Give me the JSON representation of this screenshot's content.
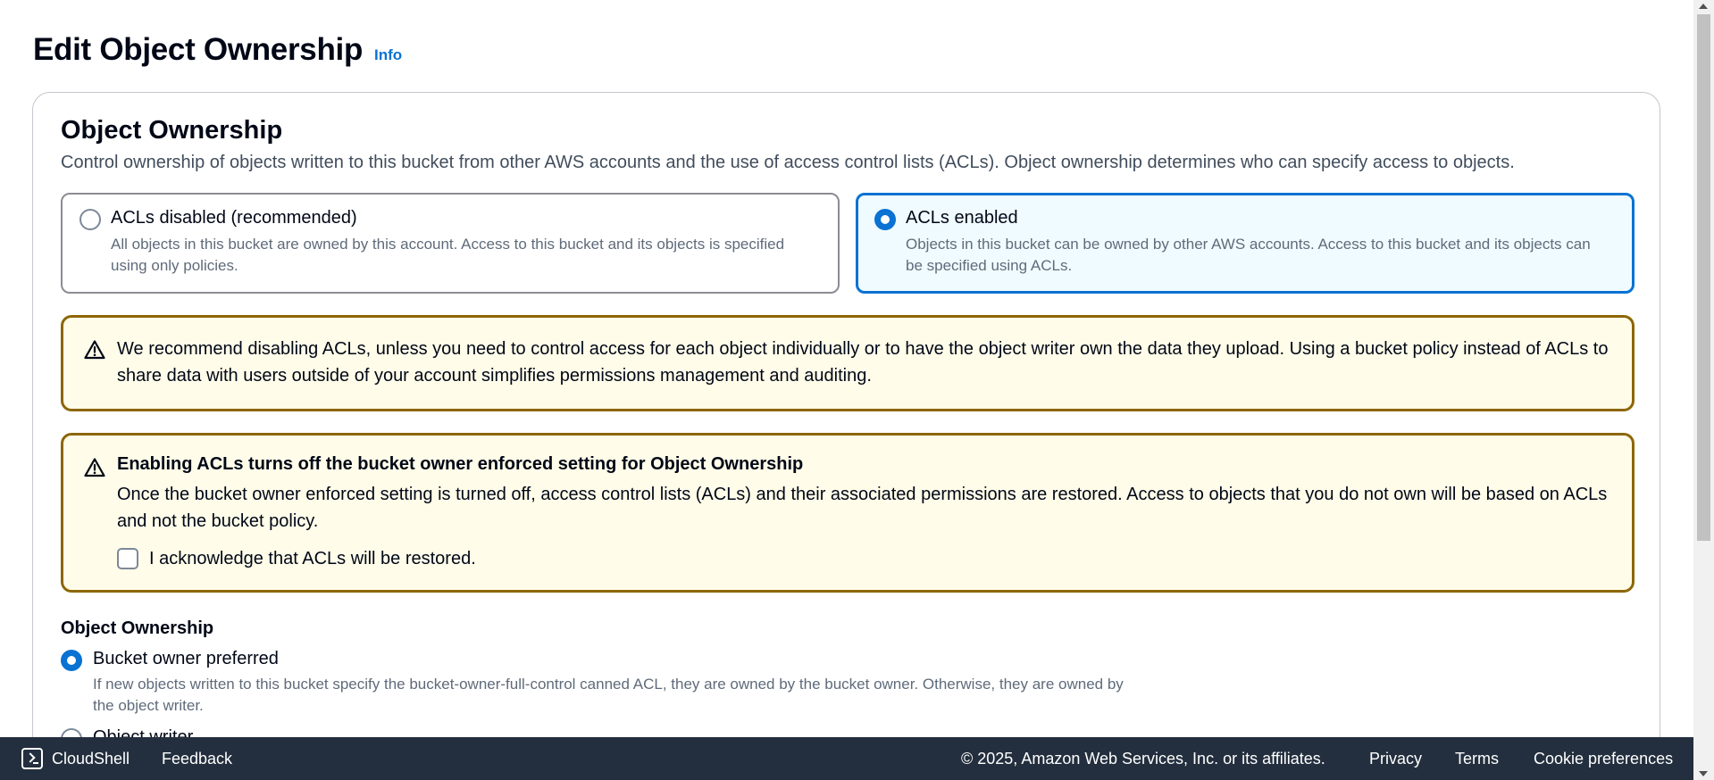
{
  "header": {
    "title": "Edit Object Ownership",
    "info_link": "Info"
  },
  "panel": {
    "title": "Object Ownership",
    "description": "Control ownership of objects written to this bucket from other AWS accounts and the use of access control lists (ACLs). Object ownership determines who can specify access to objects.",
    "tiles": [
      {
        "label": "ACLs disabled (recommended)",
        "description": "All objects in this bucket are owned by this account. Access to this bucket and its objects is specified using only policies.",
        "selected": false
      },
      {
        "label": "ACLs enabled",
        "description": "Objects in this bucket can be owned by other AWS accounts. Access to this bucket and its objects can be specified using ACLs.",
        "selected": true
      }
    ],
    "warning_recommend": {
      "text": "We recommend disabling ACLs, unless you need to control access for each object individually or to have the object writer own the data they upload. Using a bucket policy instead of ACLs to share data with users outside of your account simplifies permissions management and auditing."
    },
    "warning_enabling": {
      "title": "Enabling ACLs turns off the bucket owner enforced setting for Object Ownership",
      "text": "Once the bucket owner enforced setting is turned off, access control lists (ACLs) and their associated permissions are restored. Access to objects that you do not own will be based on ACLs and not the bucket policy.",
      "acknowledge_label": "I acknowledge that ACLs will be restored.",
      "acknowledge_checked": false
    },
    "ownership_field": {
      "label": "Object Ownership",
      "options": [
        {
          "label": "Bucket owner preferred",
          "description": "If new objects written to this bucket specify the bucket-owner-full-control canned ACL, they are owned by the bucket owner. Otherwise, they are owned by the object writer.",
          "selected": true
        },
        {
          "label": "Object writer",
          "selected": false
        }
      ]
    }
  },
  "footer": {
    "cloudshell": "CloudShell",
    "feedback": "Feedback",
    "copyright": "© 2025, Amazon Web Services, Inc. or its affiliates.",
    "privacy": "Privacy",
    "terms": "Terms",
    "cookie_preferences": "Cookie preferences"
  },
  "colors": {
    "accent": "#0972d3",
    "warning_border": "#8d6605",
    "warning_bg": "#fffce9",
    "footer_bg": "#232f3e"
  }
}
